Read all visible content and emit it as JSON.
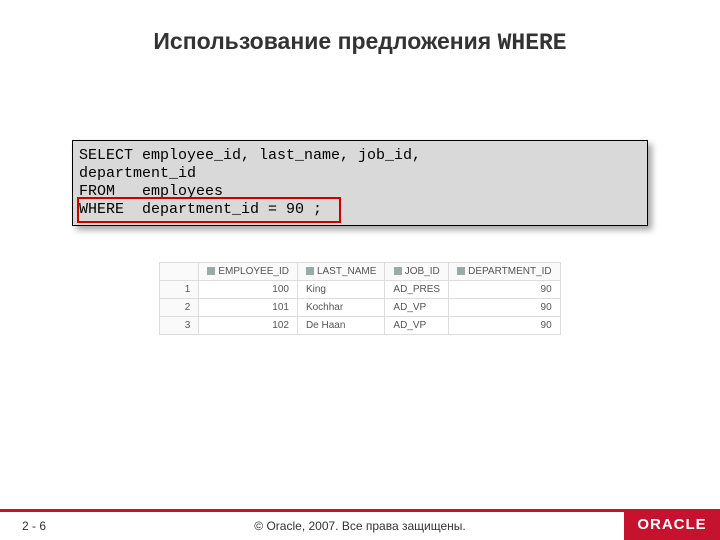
{
  "title": {
    "prefix": "Использование предложения ",
    "code": "WHERE"
  },
  "sql": {
    "line1": "SELECT employee_id, last_name, job_id,",
    "line2": "department_id",
    "line3": "FROM   employees",
    "line4": "WHERE  department_id = 90 ;"
  },
  "result": {
    "columns": [
      "EMPLOYEE_ID",
      "LAST_NAME",
      "JOB_ID",
      "DEPARTMENT_ID"
    ],
    "rows": [
      {
        "n": 1,
        "employee_id": 100,
        "last_name": "King",
        "job_id": "AD_PRES",
        "department_id": 90
      },
      {
        "n": 2,
        "employee_id": 101,
        "last_name": "Kochhar",
        "job_id": "AD_VP",
        "department_id": 90
      },
      {
        "n": 3,
        "employee_id": 102,
        "last_name": "De Haan",
        "job_id": "AD_VP",
        "department_id": 90
      }
    ]
  },
  "footer": {
    "page": "2 - 6",
    "copyright": "© Oracle, 2007. Все права защищены.",
    "logo": "ORACLE"
  }
}
